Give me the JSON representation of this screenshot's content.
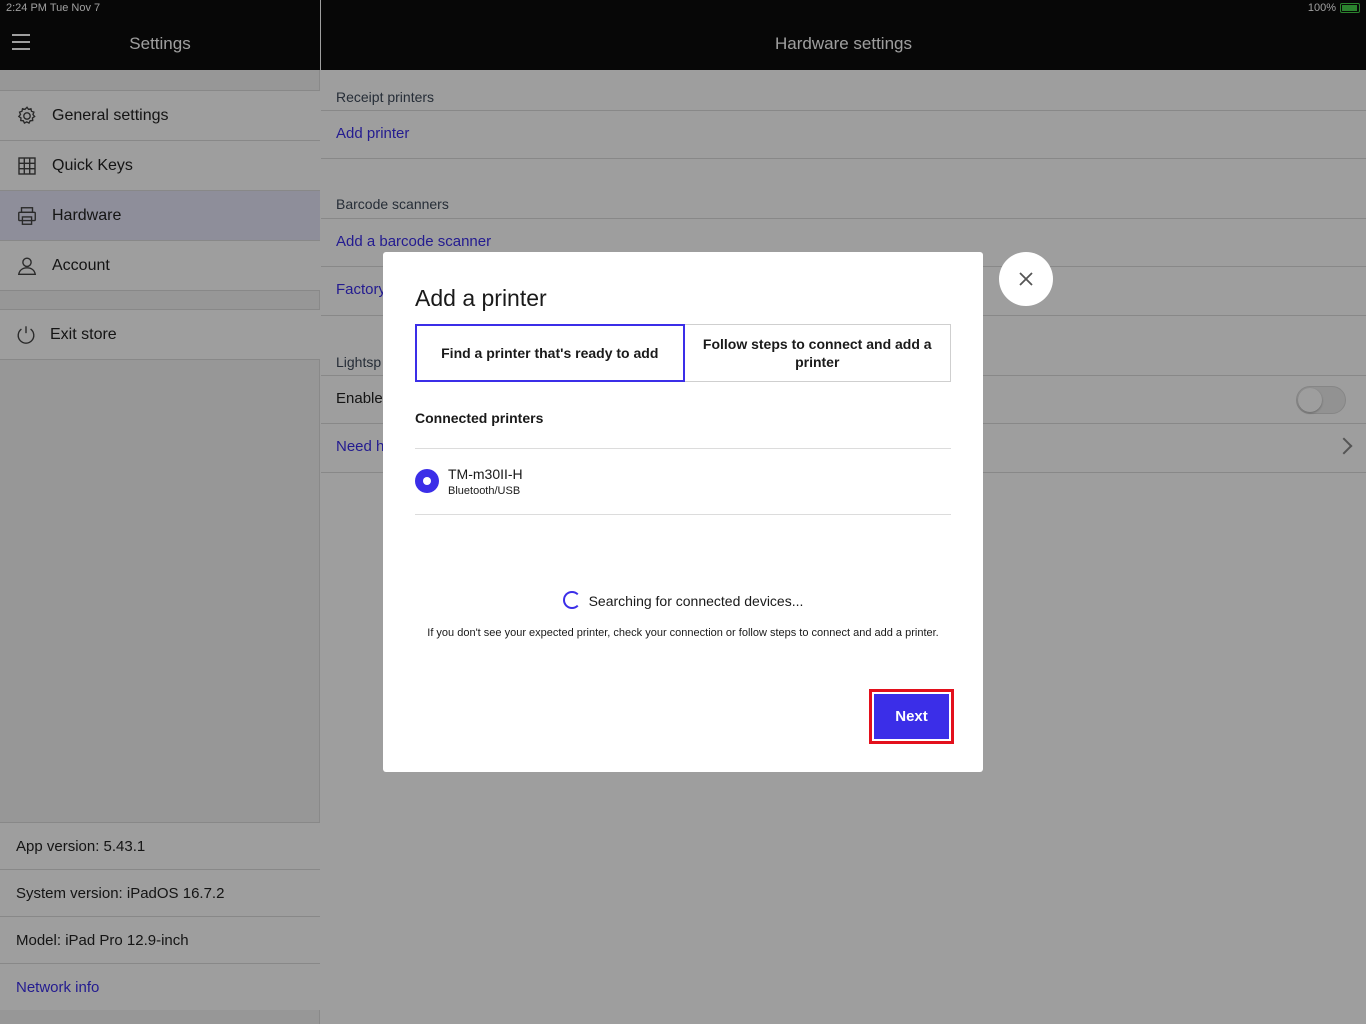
{
  "status_bar": {
    "time": "2:24 PM",
    "date": "Tue Nov 7",
    "battery": "100%"
  },
  "sidebar": {
    "title": "Settings",
    "items": [
      {
        "label": "General settings",
        "icon": "gear-icon"
      },
      {
        "label": "Quick Keys",
        "icon": "grid-icon"
      },
      {
        "label": "Hardware",
        "icon": "printer-icon",
        "active": true
      },
      {
        "label": "Account",
        "icon": "person-icon"
      }
    ],
    "exit_label": "Exit store",
    "app_version": "App version: 5.43.1",
    "system_version": "System version: iPadOS 16.7.2",
    "model": "Model: iPad Pro 12.9-inch",
    "network_info": "Network info"
  },
  "main": {
    "title": "Hardware settings",
    "receipt_section": "Receipt printers",
    "add_printer": "Add printer",
    "barcode_section": "Barcode scanners",
    "add_barcode": "Add a barcode scanner",
    "factory_row": "Factory",
    "lightspeed_section": "Lightsp",
    "enable_row": "Enable",
    "need_row": "Need h"
  },
  "modal": {
    "title": "Add a printer",
    "tab_find": "Find a printer that's ready to add",
    "tab_follow": "Follow steps to connect and add a printer",
    "connected_label": "Connected printers",
    "printer_name": "TM-m30II-H",
    "printer_conn": "Bluetooth/USB",
    "searching": "Searching for connected devices...",
    "hint": "If you don't see your expected printer, check your connection or follow steps to connect and add a printer.",
    "next_label": "Next"
  },
  "colors": {
    "accent": "#3b2ee8",
    "highlight": "#e3101c",
    "header": "#0c0c0c"
  }
}
